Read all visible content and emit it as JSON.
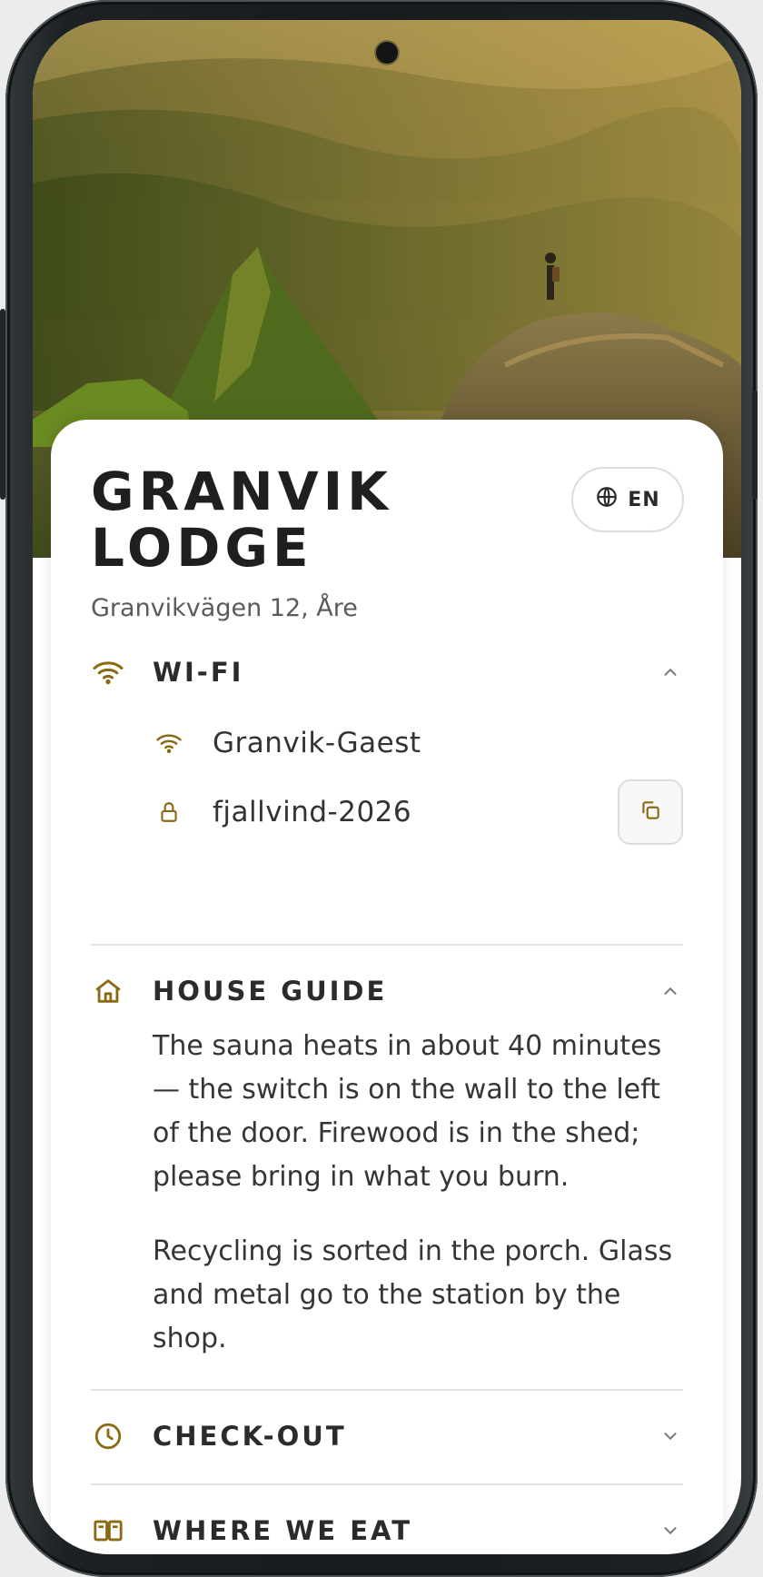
{
  "colors": {
    "accent": "#8a6a12",
    "title": "#1f1f1f",
    "text": "#353535",
    "muted": "#5b5b5b",
    "divider": "#e2e2e2"
  },
  "header": {
    "title": "GRANVIK LODGE",
    "address": "Granvikvägen 12, Åre",
    "language_button": {
      "icon": "globe-icon",
      "label": "EN"
    }
  },
  "sections": {
    "wifi": {
      "icon": "wifi-icon",
      "title": "WI-FI",
      "expanded": true,
      "network_icon": "wifi-icon",
      "network": "Granvik-Gaest",
      "password_icon": "lock-icon",
      "password": "fjallvind-2026",
      "copy_icon": "copy-icon"
    },
    "house_guide": {
      "icon": "home-icon",
      "title": "HOUSE GUIDE",
      "expanded": true,
      "paragraphs": [
        "The sauna heats in about 40 minutes — the switch is on the wall to the left of the door. Firewood is in the shed; please bring in what you burn.",
        "Recycling is sorted in the porch. Glass and metal go to the station by the shop."
      ]
    },
    "checkout": {
      "icon": "clock-icon",
      "title": "CHECK-OUT",
      "expanded": false
    },
    "where_we_eat": {
      "icon": "book-icon",
      "title": "WHERE WE EAT",
      "expanded": false
    }
  }
}
